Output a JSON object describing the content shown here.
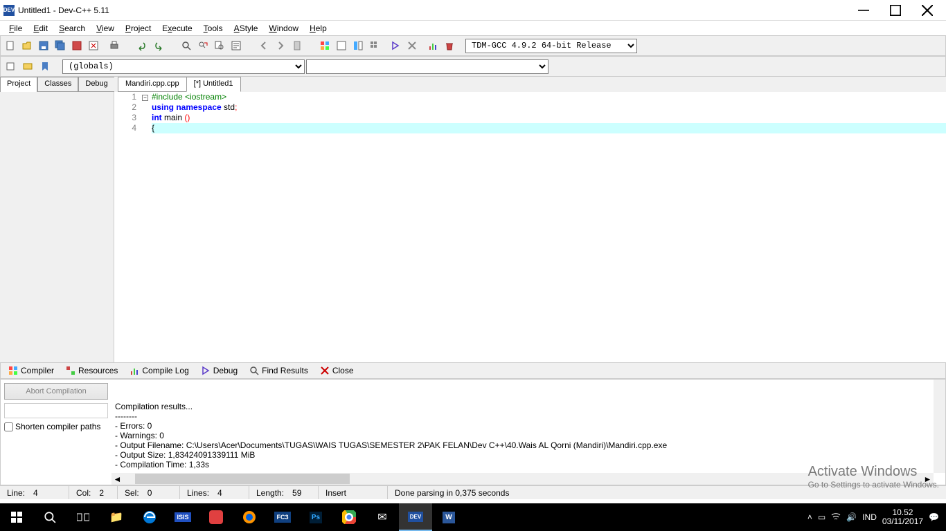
{
  "title": "Untitled1 - Dev-C++ 5.11",
  "menus": [
    "File",
    "Edit",
    "Search",
    "View",
    "Project",
    "Execute",
    "Tools",
    "AStyle",
    "Window",
    "Help"
  ],
  "compiler_select": "TDM-GCC 4.9.2 64-bit Release",
  "globals_select": "(globals)",
  "sidebar_tabs": [
    "Project",
    "Classes",
    "Debug"
  ],
  "editor_tabs": [
    "Mandiri.cpp.cpp",
    "[*] Untitled1"
  ],
  "code": {
    "lines": [
      {
        "n": 1,
        "tokens": [
          [
            "#include ",
            "pre"
          ],
          [
            "<iostream>",
            "inc"
          ]
        ]
      },
      {
        "n": 2,
        "tokens": [
          [
            "using namespace ",
            "blue"
          ],
          [
            "std",
            "black"
          ],
          [
            ";",
            "semi"
          ]
        ]
      },
      {
        "n": 3,
        "tokens": [
          [
            "int ",
            "blue"
          ],
          [
            "main ",
            "black"
          ],
          [
            "()",
            "paren"
          ]
        ]
      },
      {
        "n": 4,
        "tokens": [
          [
            "{",
            "black"
          ]
        ],
        "current": true,
        "fold": true
      }
    ]
  },
  "bottom_tabs": [
    "Compiler",
    "Resources",
    "Compile Log",
    "Debug",
    "Find Results",
    "Close"
  ],
  "abort_btn": "Abort Compilation",
  "shorten_label": "Shorten compiler paths",
  "log_text": "Compilation results...\n--------\n- Errors: 0\n- Warnings: 0\n- Output Filename: C:\\Users\\Acer\\Documents\\TUGAS\\WAIS TUGAS\\SEMESTER 2\\PAK FELAN\\Dev C++\\40.Wais AL Qorni (Mandiri)\\Mandiri.cpp.exe\n- Output Size: 1,83424091339111 MiB\n- Compilation Time: 1,33s",
  "status": {
    "line_lbl": "Line:",
    "line": "4",
    "col_lbl": "Col:",
    "col": "2",
    "sel_lbl": "Sel:",
    "sel": "0",
    "lines_lbl": "Lines:",
    "lines": "4",
    "len_lbl": "Length:",
    "len": "59",
    "mode": "Insert",
    "msg": "Done parsing in 0,375 seconds"
  },
  "watermark_title": "Activate Windows",
  "watermark_sub": "Go to Settings to activate Windows.",
  "tray": {
    "lang": "IND",
    "time": "10.52",
    "date": "03/11/2017"
  }
}
